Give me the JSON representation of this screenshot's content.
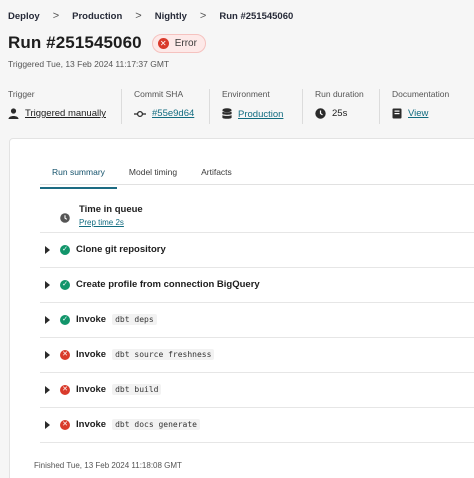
{
  "breadcrumb": {
    "items": [
      "Deploy",
      "Production",
      "Nightly",
      "Run #251545060"
    ],
    "separator": ">"
  },
  "header": {
    "title": "Run #251545060",
    "status": "Error",
    "status_icon": "error-x-icon",
    "triggered_at": "Triggered Tue, 13 Feb 2024 11:17:37 GMT"
  },
  "meta": {
    "trigger": {
      "label": "Trigger",
      "value": "Triggered manually",
      "icon": "user-icon"
    },
    "commit": {
      "label": "Commit SHA",
      "value": "#55e9d64",
      "icon": "commit-icon"
    },
    "environment": {
      "label": "Environment",
      "value": "Production",
      "icon": "database-icon"
    },
    "duration": {
      "label": "Run duration",
      "value": "25s",
      "icon": "clock-icon"
    },
    "docs": {
      "label": "Documentation",
      "value": "View",
      "icon": "book-icon"
    }
  },
  "tabs": [
    "Run summary",
    "Model timing",
    "Artifacts"
  ],
  "queue": {
    "title": "Time in queue",
    "subtitle": "Prep time 2s"
  },
  "steps": [
    {
      "status": "success",
      "label": "Clone git repository",
      "code": ""
    },
    {
      "status": "success",
      "label": "Create profile from connection BigQuery",
      "code": ""
    },
    {
      "status": "success",
      "label": "Invoke",
      "code": "dbt deps"
    },
    {
      "status": "error",
      "label": "Invoke",
      "code": "dbt source freshness"
    },
    {
      "status": "error",
      "label": "Invoke",
      "code": "dbt build"
    },
    {
      "status": "error",
      "label": "Invoke",
      "code": "dbt docs generate"
    }
  ],
  "finished_at": "Finished Tue, 13 Feb 2024 11:18:08 GMT",
  "colors": {
    "accent": "#126c80",
    "success": "#12956b",
    "error": "#d93a2b"
  }
}
